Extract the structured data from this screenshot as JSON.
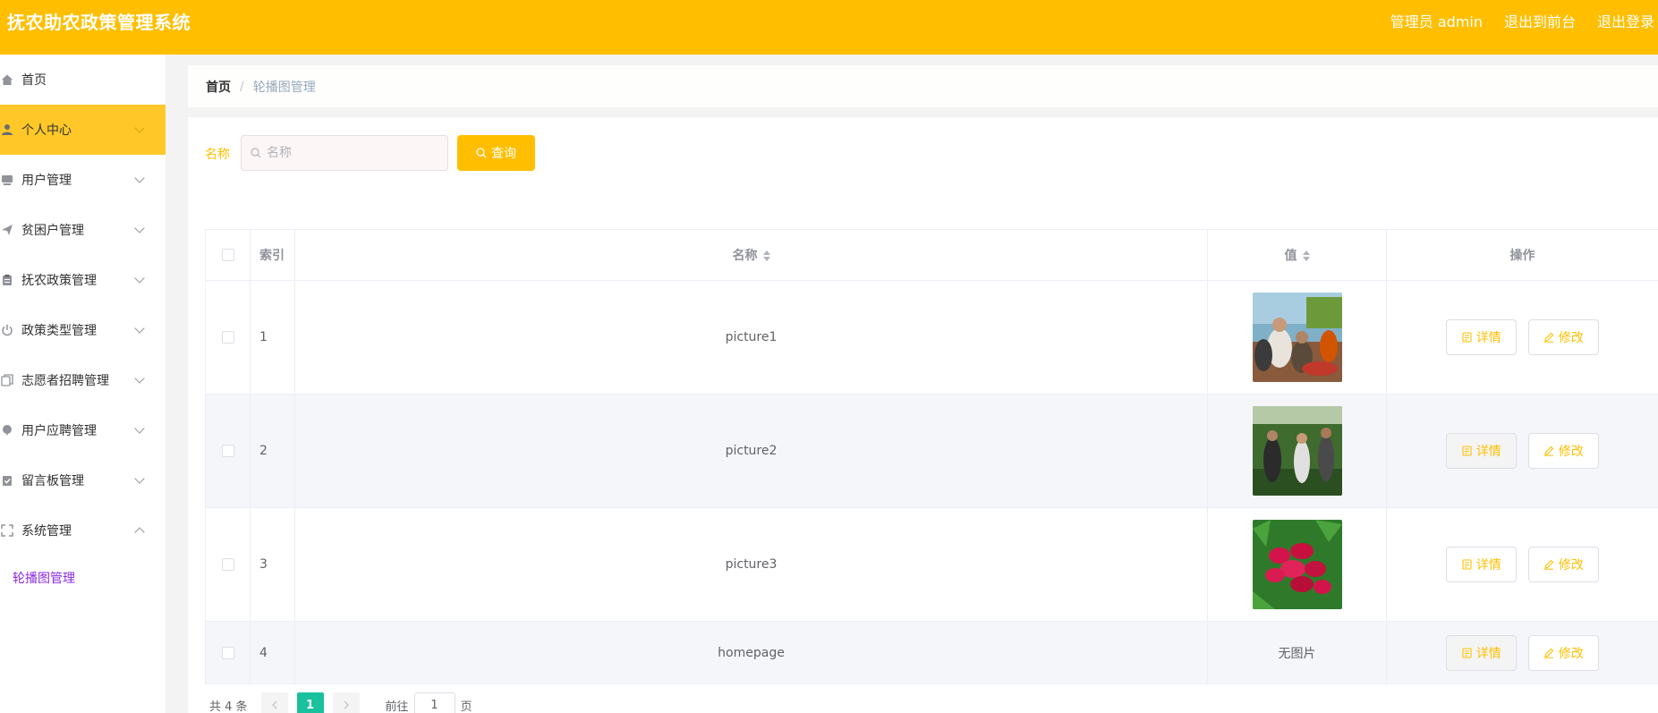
{
  "header": {
    "title": "抚农助农政策管理系统",
    "user_label": "管理员 admin",
    "to_front": "退出到前台",
    "logout": "退出登录"
  },
  "sidebar": {
    "items": [
      {
        "label": "首页",
        "icon": "home-icon"
      },
      {
        "label": "个人中心",
        "icon": "user-icon",
        "active": true
      },
      {
        "label": "用户管理",
        "icon": "monitor-icon"
      },
      {
        "label": "贫困户管理",
        "icon": "send-icon"
      },
      {
        "label": "抚农政策管理",
        "icon": "clipboard-icon"
      },
      {
        "label": "政策类型管理",
        "icon": "power-icon"
      },
      {
        "label": "志愿者招聘管理",
        "icon": "copy-icon"
      },
      {
        "label": "用户应聘管理",
        "icon": "balloon-icon"
      },
      {
        "label": "留言板管理",
        "icon": "checklist-icon"
      },
      {
        "label": "系统管理",
        "icon": "fullscreen-icon",
        "expanded": true
      }
    ],
    "sub_item": "轮播图管理"
  },
  "breadcrumb": {
    "home": "首页",
    "separator": "/",
    "current": "轮播图管理"
  },
  "search": {
    "label": "名称",
    "placeholder": "名称",
    "value": "",
    "button": "查询"
  },
  "table": {
    "headers": {
      "index": "索引",
      "name": "名称",
      "value": "值",
      "actions": "操作"
    },
    "rows": [
      {
        "index": "1",
        "name": "picture1",
        "image": "photo-people-dining",
        "value_text": ""
      },
      {
        "index": "2",
        "name": "picture2",
        "image": "photo-people-field",
        "value_text": ""
      },
      {
        "index": "3",
        "name": "picture3",
        "image": "photo-red-radishes",
        "value_text": ""
      },
      {
        "index": "4",
        "name": "homepage",
        "image": "",
        "value_text": "无图片"
      }
    ],
    "detail_label": "详情",
    "edit_label": "修改"
  },
  "pagination": {
    "total": "共 4 条",
    "current_page": "1",
    "goto_label": "前往",
    "goto_value": "1",
    "page_suffix": "页"
  },
  "colors": {
    "accent": "#ffbf00",
    "active_menu": "#ffc828",
    "page_active": "#19c19c",
    "submenu_text": "#8a2be2"
  }
}
